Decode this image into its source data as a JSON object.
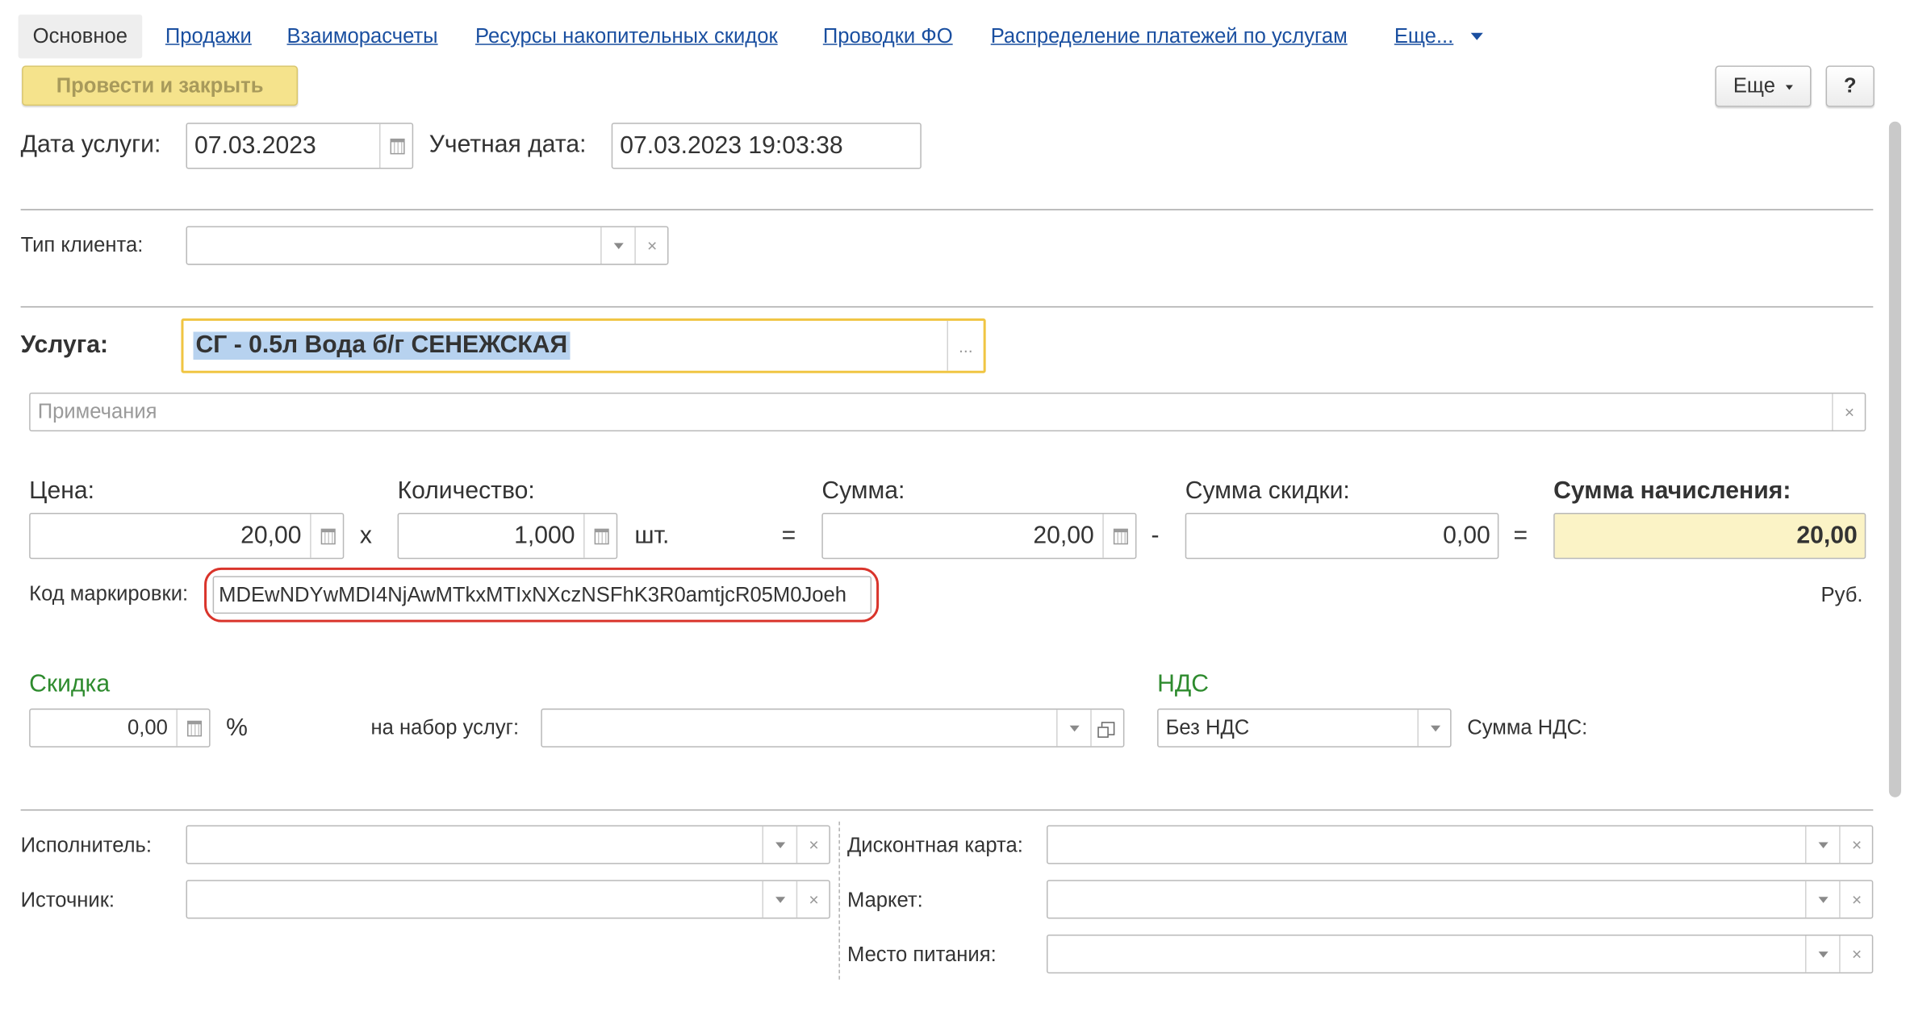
{
  "tabs": [
    {
      "label": "Основное"
    },
    {
      "label": "Продажи"
    },
    {
      "label": "Взаиморасчеты"
    },
    {
      "label": "Ресурсы накопительных скидок"
    },
    {
      "label": "Проводки ФО"
    },
    {
      "label": "Распределение платежей по услугам"
    },
    {
      "label": "Еще..."
    }
  ],
  "toolbar": {
    "post_close_label": "Провести и закрыть",
    "more_label": "Еще",
    "help_label": "?"
  },
  "dates": {
    "service_date_label": "Дата услуги:",
    "service_date_value": "07.03.2023",
    "account_date_label": "Учетная дата:",
    "account_date_value": "07.03.2023 19:03:38"
  },
  "client_type": {
    "label": "Тип клиента:",
    "value": ""
  },
  "service": {
    "label": "Услуга:",
    "value": "СГ - 0.5л Вода б/г СЕНЕЖСКАЯ",
    "more_label": "..."
  },
  "notes": {
    "placeholder": "Примечания"
  },
  "calc": {
    "price_label": "Цена:",
    "price_value": "20,00",
    "qty_label": "Количество:",
    "qty_value": "1,000",
    "unit": "шт.",
    "sum_label": "Сумма:",
    "sum_value": "20,00",
    "discount_sum_label": "Сумма скидки:",
    "discount_sum_value": "0,00",
    "charge_label": "Сумма начисления:",
    "charge_value": "20,00",
    "op_x": "x",
    "op_eq1": "=",
    "op_minus": "-",
    "op_eq2": "=",
    "currency": "Руб."
  },
  "marking": {
    "label": "Код маркировки:",
    "value": "MDEwNDYwMDI4NjAwMTkxMTIxNXczNSFhK3R0amtjcR05M0Joeh"
  },
  "discount": {
    "title": "Скидка",
    "value": "0,00",
    "percent": "%",
    "set_label": "на набор услуг:",
    "set_value": ""
  },
  "vat": {
    "title": "НДС",
    "value": "Без НДС",
    "sum_label": "Сумма НДС:"
  },
  "bottom": {
    "executor_label": "Исполнитель:",
    "source_label": "Источник:",
    "discount_card_label": "Дисконтная карта:",
    "market_label": "Маркет:",
    "meal_place_label": "Место питания:"
  },
  "colors": {
    "link": "#1a4fa0",
    "accent_yellow": "#f5e38c",
    "focus_border": "#f0c543",
    "green": "#2e8b2e",
    "highlight_red": "#d9342b"
  }
}
